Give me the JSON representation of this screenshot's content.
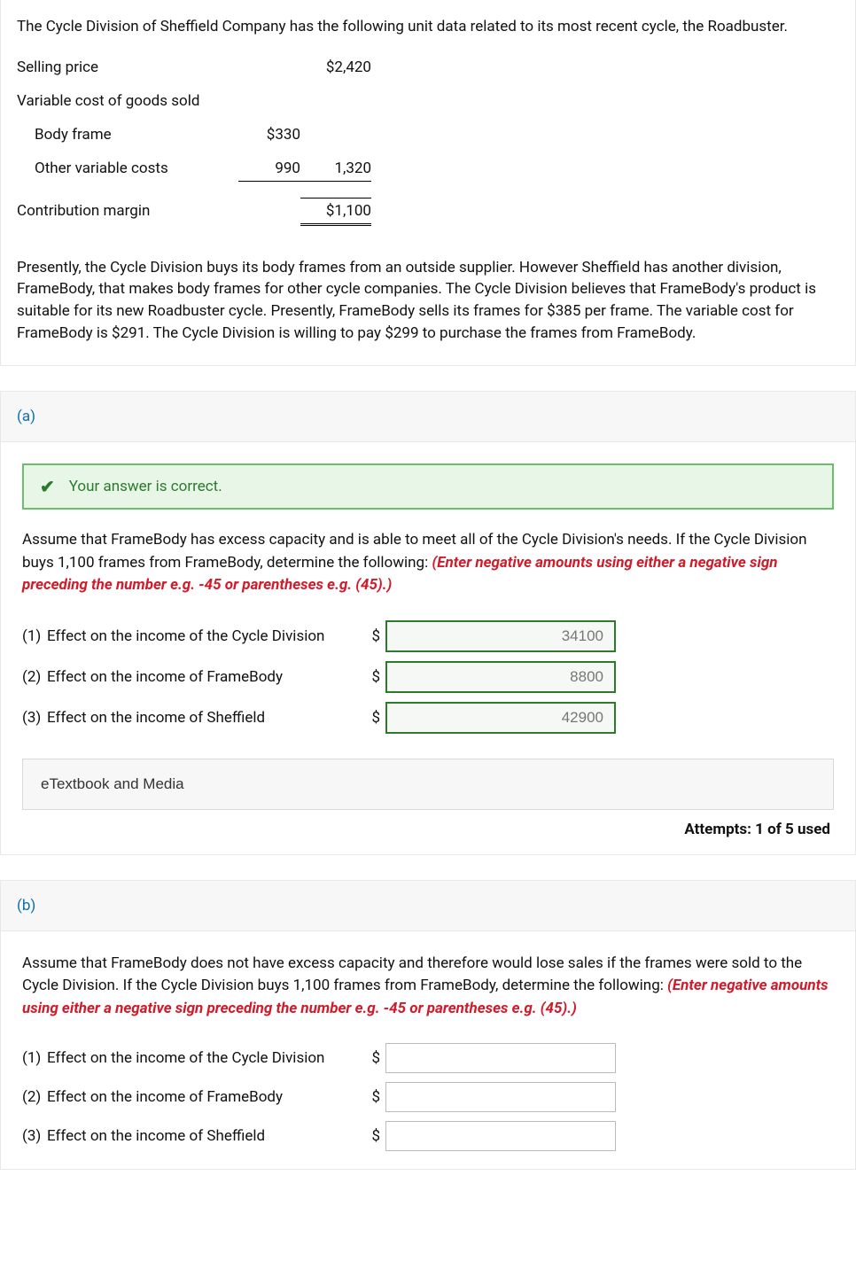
{
  "main": {
    "intro": "The Cycle Division of Sheffield Company has the following unit data related to its most recent cycle, the Roadbuster.",
    "table": {
      "selling_price_label": "Selling price",
      "selling_price_value": "$2,420",
      "vcogs_label": "Variable cost of goods sold",
      "body_frame_label": "Body frame",
      "body_frame_value": "$330",
      "other_var_label": "Other variable costs",
      "other_var_value": "990",
      "vcogs_total": "1,320",
      "contribution_label": "Contribution margin",
      "contribution_value": "$1,100"
    },
    "paragraph": "Presently, the Cycle Division buys its body frames from an outside supplier. However Sheffield has another division, FrameBody, that makes body frames for other cycle companies. The Cycle Division believes that FrameBody's product is suitable for its new Roadbuster cycle. Presently, FrameBody sells its frames for $385 per frame. The variable cost for FrameBody is $291. The Cycle Division is willing to pay $299 to purchase the frames from FrameBody."
  },
  "part_a": {
    "label": "(a)",
    "banner_text": "Your answer is correct.",
    "prompt_pre": "Assume that FrameBody has excess capacity and is able to meet all of the Cycle Division's needs. If the Cycle Division buys 1,100 frames from FrameBody, determine the following: ",
    "hint": "(Enter negative amounts using either a negative sign preceding the number e.g. -45 or parentheses e.g. (45).)",
    "rows": [
      {
        "num": "(1)",
        "label": "Effect on the income of the Cycle Division",
        "dollar": "$",
        "value": "34100"
      },
      {
        "num": "(2)",
        "label": "Effect on the income of FrameBody",
        "dollar": "$",
        "value": "8800"
      },
      {
        "num": "(3)",
        "label": "Effect on the income of Sheffield",
        "dollar": "$",
        "value": "42900"
      }
    ],
    "etext_label": "eTextbook and Media",
    "attempts": "Attempts: 1 of 5 used"
  },
  "part_b": {
    "label": "(b)",
    "prompt_pre": "Assume that FrameBody does not have excess capacity and therefore would lose sales if the frames were sold to the Cycle Division. If the Cycle Division buys 1,100 frames from FrameBody, determine the following: ",
    "hint": "(Enter negative amounts using either a negative sign preceding the number e.g. -45 or parentheses e.g. (45).)",
    "rows": [
      {
        "num": "(1)",
        "label": "Effect on the income of the Cycle Division",
        "dollar": "$"
      },
      {
        "num": "(2)",
        "label": "Effect on the income of FrameBody",
        "dollar": "$"
      },
      {
        "num": "(3)",
        "label": "Effect on the income of Sheffield",
        "dollar": "$"
      }
    ]
  }
}
